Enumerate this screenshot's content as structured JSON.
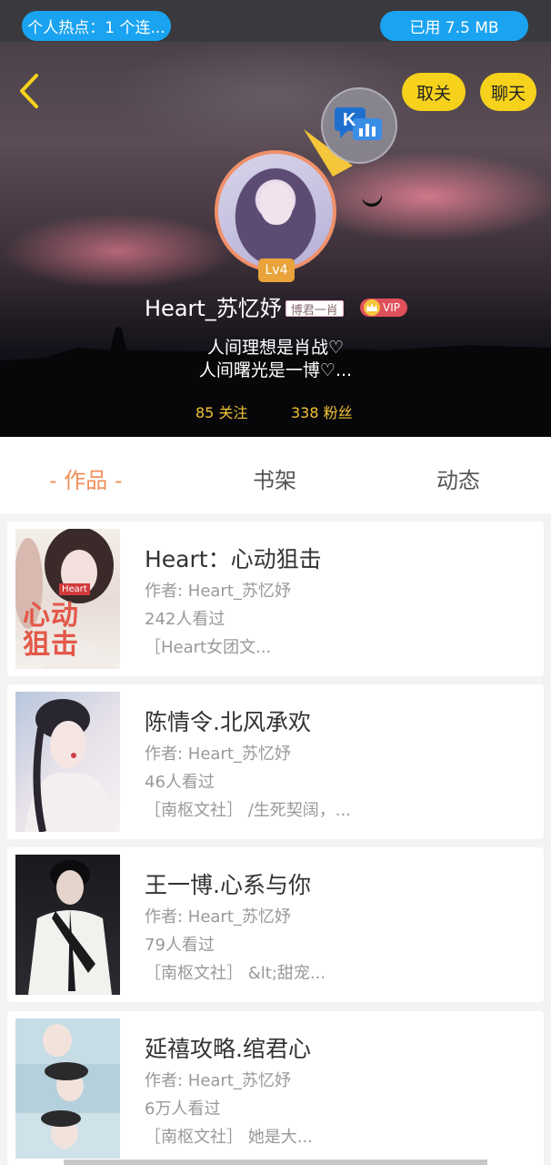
{
  "status": {
    "hotspot": "个人热点：1 个连...",
    "storage": "已用 7.5 MB"
  },
  "header": {
    "unfollow_label": "取关",
    "chat_label": "聊天",
    "level": "Lv4",
    "nickname": "Heart_苏忆妤",
    "name_sticker": "博君一肖",
    "vip_label": "VIP",
    "bio_line1": "人间理想是肖战♡",
    "bio_line2": "人间曙光是一博♡...",
    "following": "85 关注",
    "fans": "338 粉丝",
    "k_badge_letter": "K"
  },
  "tabs": [
    {
      "label": "- 作品 -",
      "active": true
    },
    {
      "label": "书架",
      "active": false
    },
    {
      "label": "动态",
      "active": false
    }
  ],
  "books": [
    {
      "title": "Heart：心动狙击",
      "author": "作者: Heart_苏忆妤",
      "views": "242人看过",
      "tags": "［Heart女团文...",
      "cover_text": "心动\n狙击",
      "cover_mini": "Heart"
    },
    {
      "title": "陈情令.北风承欢",
      "author": "作者: Heart_苏忆妤",
      "views": "46人看过",
      "tags": "［南枢文社］ /生死契阔，..."
    },
    {
      "title": "王一博.心系与你",
      "author": "作者: Heart_苏忆妤",
      "views": "79人看过",
      "tags": "［南枢文社］ &lt;甜宠..."
    },
    {
      "title": "延禧攻略.绾君心",
      "author": "作者: Heart_苏忆妤",
      "views": "6万人看过",
      "tags": "［南枢文社］ 她是大..."
    }
  ],
  "colors": {
    "accent": "#f0905a",
    "chip": "#1aa3f1",
    "pill": "#f6d21c",
    "stats": "#f2c338"
  }
}
